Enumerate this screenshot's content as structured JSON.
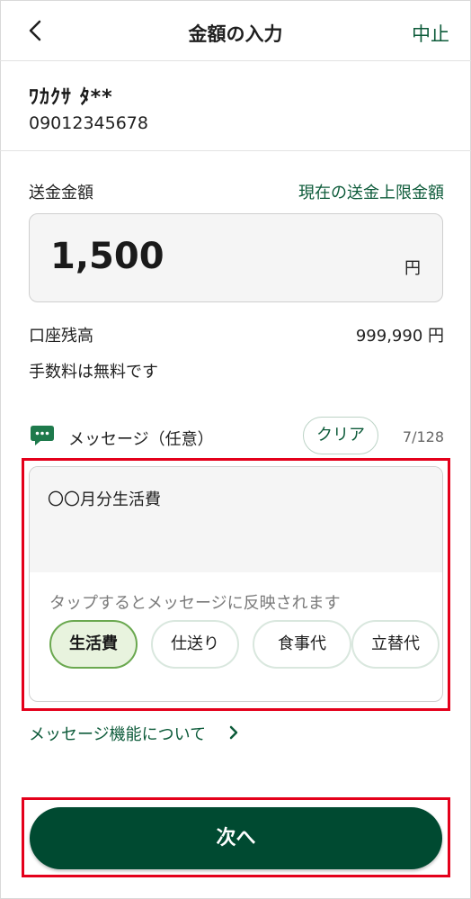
{
  "header": {
    "title": "金額の入力",
    "cancel_label": "中止",
    "back_icon": "chevron-left-icon"
  },
  "recipient": {
    "name": "ﾜｶｸｻ ﾀ**",
    "phone": "09012345678"
  },
  "amount": {
    "label": "送金金額",
    "limit_link": "現在の送金上限金額",
    "value": "1,500",
    "unit": "円"
  },
  "balance": {
    "label": "口座残高",
    "value": "999,990 円"
  },
  "fee_text": "手数料は無料です",
  "message": {
    "icon": "chat-bubble-icon",
    "label": "メッセージ（任意）",
    "clear_label": "クリア",
    "count": "7/128",
    "text": "〇〇月分生活費",
    "hint": "タップするとメッセージに反映されます",
    "chips": [
      {
        "label": "生活費",
        "selected": true
      },
      {
        "label": "仕送り",
        "selected": false
      },
      {
        "label": "食事代",
        "selected": false
      },
      {
        "label": "立替代",
        "selected": false
      }
    ]
  },
  "feature_link": "メッセージ機能について",
  "next_label": "次へ",
  "colors": {
    "brand_green": "#004a31",
    "link_green": "#0d5b3a",
    "highlight_red": "#e4001b",
    "chip_selected_bg": "#e8f3de"
  }
}
